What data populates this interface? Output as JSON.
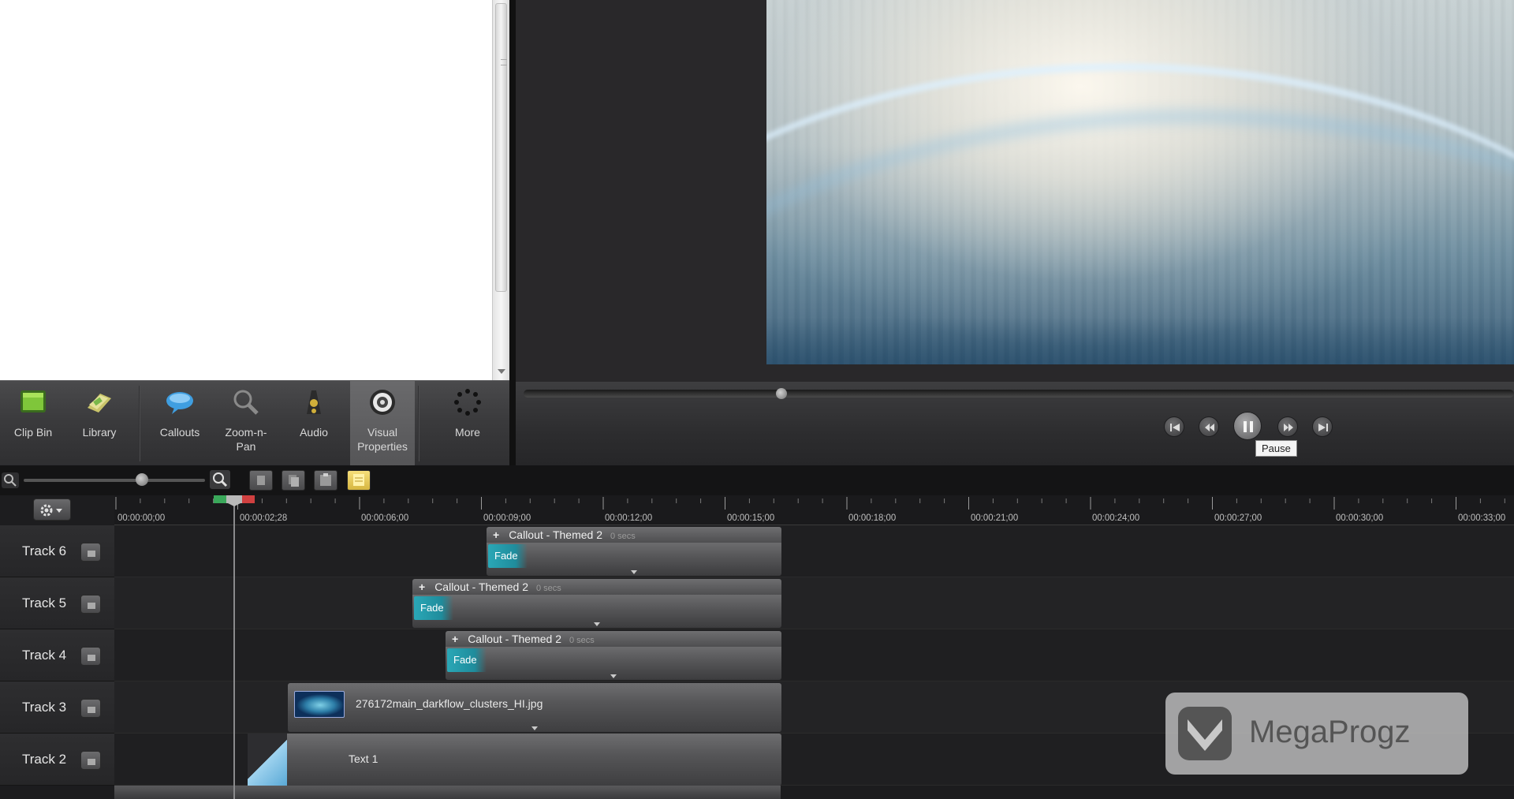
{
  "toolbar": {
    "tools": [
      {
        "id": "clip-bin",
        "label": "Clip Bin"
      },
      {
        "id": "library",
        "label": "Library"
      },
      {
        "id": "callouts",
        "label": "Callouts"
      },
      {
        "id": "zoom-n-pan",
        "label": "Zoom-n-\nPan"
      },
      {
        "id": "audio",
        "label": "Audio"
      },
      {
        "id": "visual-properties",
        "label": "Visual\nProperties"
      },
      {
        "id": "more",
        "label": "More"
      }
    ]
  },
  "transport": {
    "tooltip": "Pause"
  },
  "ruler": {
    "ticks": [
      "00:00:00;00",
      "00:00:02;28",
      "00:00:06;00",
      "00:00:09;00",
      "00:00:12;00",
      "00:00:15;00",
      "00:00:18;00",
      "00:00:21;00",
      "00:00:24;00",
      "00:00:27;00",
      "00:00:30;00",
      "00:00:33;00"
    ]
  },
  "tracks": [
    {
      "name": "Track 6"
    },
    {
      "name": "Track 5"
    },
    {
      "name": "Track 4"
    },
    {
      "name": "Track 3"
    },
    {
      "name": "Track 2"
    }
  ],
  "clips": {
    "callout1": {
      "title": "Callout - Themed 2",
      "dur": "0 secs",
      "fade": "Fade"
    },
    "callout2": {
      "title": "Callout - Themed 2",
      "dur": "0 secs",
      "fade": "Fade"
    },
    "callout3": {
      "title": "Callout - Themed 2",
      "dur": "0 secs",
      "fade": "Fade"
    },
    "image": {
      "label": "276172main_darkflow_clusters_HI.jpg"
    },
    "text": {
      "label": "Text 1"
    }
  },
  "watermark": {
    "text": "MegaProgz"
  },
  "colors": {
    "fade": "#2aa7b6",
    "note": "#e8c85a"
  },
  "icons": [
    "clip-bin-icon",
    "library-icon",
    "callouts-icon",
    "zoom-n-pan-icon",
    "audio-icon",
    "visual-properties-icon",
    "more-icon",
    "jump-to-start-icon",
    "step-back-icon",
    "pause-icon",
    "step-forward-icon",
    "jump-to-end-icon",
    "zoom-out-icon",
    "zoom-in-icon",
    "cut-icon",
    "copy-icon",
    "paste-icon",
    "marker-note-icon",
    "gear-icon",
    "lock-icon"
  ]
}
